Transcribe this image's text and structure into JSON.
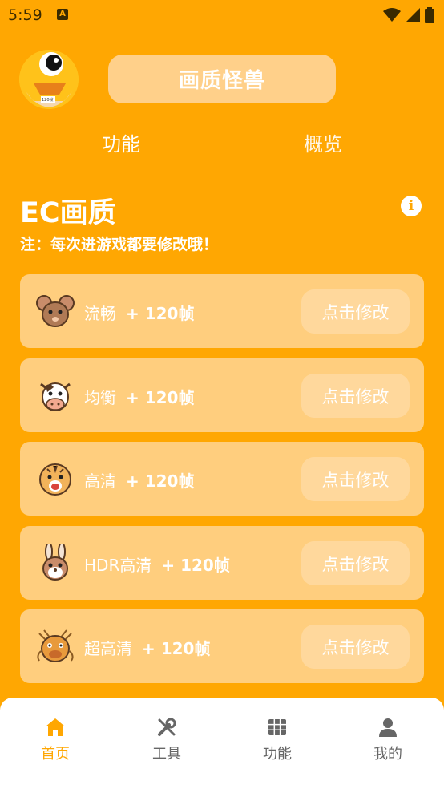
{
  "status": {
    "time": "5:59"
  },
  "header": {
    "title": "画质怪兽",
    "avatar_badge": "120帧"
  },
  "tabs": [
    "功能",
    "概览"
  ],
  "section": {
    "title": "EC画质",
    "note": "注：每次进游戏都要修改哦！"
  },
  "cards": [
    {
      "mode": "流畅",
      "fps": "+ 120帧",
      "button": "点击修改",
      "icon": "mouse-icon"
    },
    {
      "mode": "均衡",
      "fps": "+ 120帧",
      "button": "点击修改",
      "icon": "cow-icon"
    },
    {
      "mode": "高清",
      "fps": "+ 120帧",
      "button": "点击修改",
      "icon": "tiger-icon"
    },
    {
      "mode": "HDR高清",
      "fps": "+ 120帧",
      "button": "点击修改",
      "icon": "rabbit-icon"
    },
    {
      "mode": "超高清",
      "fps": "+ 120帧",
      "button": "点击修改",
      "icon": "dragon-icon"
    }
  ],
  "bottom_nav": [
    {
      "label": "首页",
      "icon": "home-icon",
      "active": true
    },
    {
      "label": "工具",
      "icon": "tools-icon",
      "active": false
    },
    {
      "label": "功能",
      "icon": "grid-icon",
      "active": false
    },
    {
      "label": "我的",
      "icon": "user-icon",
      "active": false
    }
  ],
  "colors": {
    "accent": "#FFA702",
    "card": "#FFCE7E",
    "button": "#FFD89C"
  }
}
